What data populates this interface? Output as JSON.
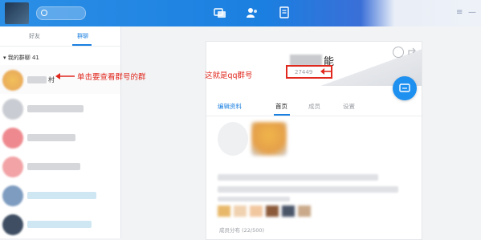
{
  "topbar": {
    "nav": [
      "message-icon",
      "contacts-icon",
      "apps-icon"
    ],
    "window_controls": [
      "menu-icon",
      "minimize-icon"
    ]
  },
  "sidebar": {
    "tabs": [
      {
        "label": "好友",
        "active": false
      },
      {
        "label": "群聊",
        "active": true
      }
    ],
    "group_header": "▾ 我的群聊 41",
    "first_group_suffix": "村"
  },
  "panel": {
    "title_suffix": "能",
    "group_number": "27449",
    "tabs": [
      {
        "label": "编辑资料"
      },
      {
        "label": "首页",
        "active": true
      },
      {
        "label": "成员"
      },
      {
        "label": "设置"
      }
    ],
    "members_count": "成员分布 (22/500)"
  },
  "annotations": {
    "left_note": "单击要查看群号的群",
    "right_note": "这就是qq群号",
    "color": "#e0281e"
  }
}
